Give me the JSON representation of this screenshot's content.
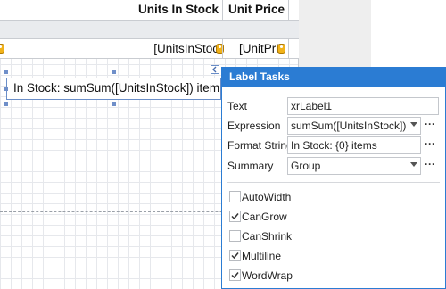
{
  "report": {
    "header_cells": [
      "Units In Stock",
      "Unit Price"
    ],
    "detail_cells": [
      "[UnitsInStoc",
      "[UnitPric"
    ],
    "selected_label_text": "In Stock: sumSum([UnitsInStock]) item"
  },
  "tasks_panel": {
    "title": "Label Tasks",
    "accent_color": "#2b7cd3",
    "properties": [
      {
        "label": "Text",
        "value": "xrLabel1",
        "has_dropdown": false,
        "has_ellipsis": false
      },
      {
        "label": "Expression",
        "value": "sumSum([UnitsInStock])",
        "has_dropdown": true,
        "has_ellipsis": true
      },
      {
        "label": "Format String",
        "value": "In Stock: {0} items",
        "has_dropdown": false,
        "has_ellipsis": true
      },
      {
        "label": "Summary",
        "value": "Group",
        "has_dropdown": true,
        "has_ellipsis": true
      }
    ],
    "checkboxes": [
      {
        "label": "AutoWidth",
        "checked": false
      },
      {
        "label": "CanGrow",
        "checked": true
      },
      {
        "label": "CanShrink",
        "checked": false
      },
      {
        "label": "Multiline",
        "checked": true
      },
      {
        "label": "WordWrap",
        "checked": true
      }
    ]
  },
  "icons": {
    "field_tag": "field-tag-icon",
    "smart_tag": "smart-tag-chevron-icon",
    "dropdown": "chevron-down-icon",
    "ellipsis": "ellipsis-icon",
    "check": "checkmark-icon"
  }
}
